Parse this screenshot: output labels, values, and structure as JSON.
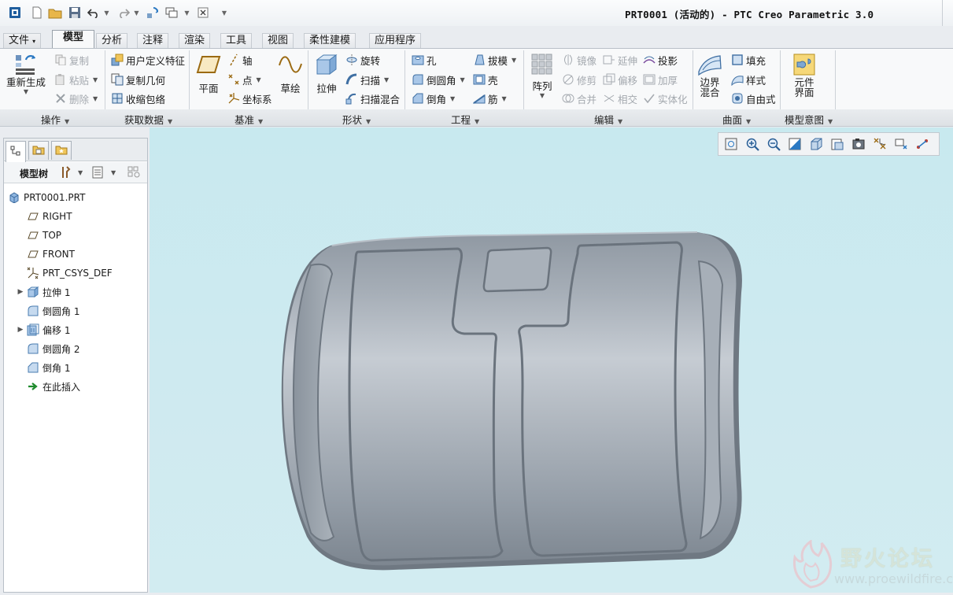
{
  "app": {
    "title": "PRT0001 (活动的) - PTC Creo Parametric 3.0"
  },
  "ribbon_tabs": [
    {
      "label": "文件",
      "caret": "▾"
    },
    {
      "label": "模型"
    },
    {
      "label": "分析"
    },
    {
      "label": "注释"
    },
    {
      "label": "渲染"
    },
    {
      "label": "工具"
    },
    {
      "label": "视图"
    },
    {
      "label": "柔性建模"
    },
    {
      "label": "应用程序"
    }
  ],
  "groups": {
    "operations": {
      "label": "操作",
      "regenerate": "重新生成",
      "copy": "复制",
      "paste": "粘贴",
      "delete": "删除"
    },
    "get_data": {
      "label": "获取数据",
      "udf": "用户定义特征",
      "copy_geom": "复制几何",
      "shrinkwrap": "收缩包络"
    },
    "datum": {
      "label": "基准",
      "plane": "平面",
      "axis": "轴",
      "point": "点",
      "csys": "坐标系",
      "sketch": "草绘"
    },
    "shapes": {
      "label": "形状",
      "extrude": "拉伸",
      "revolve": "旋转",
      "sweep": "扫描",
      "swept_blend": "扫描混合"
    },
    "engineering": {
      "label": "工程",
      "hole": "孔",
      "round": "倒圆角",
      "chamfer": "倒角",
      "draft": "拔模",
      "shell": "壳",
      "rib": "筋"
    },
    "editing": {
      "label": "编辑",
      "pattern": "阵列",
      "mirror": "镜像",
      "trim": "修剪",
      "merge": "合并",
      "extend": "延伸",
      "offset": "偏移",
      "intersect": "相交",
      "project": "投影",
      "thicken": "加厚",
      "solidify": "实体化"
    },
    "surfaces": {
      "label": "曲面",
      "boundary_blend": "边界\n混合",
      "fill": "填充",
      "style": "样式",
      "freestyle": "自由式"
    },
    "model_intent": {
      "label": "模型意图",
      "component_interface": "元件\n界面"
    }
  },
  "model_tree": {
    "header": "模型树",
    "items": [
      {
        "label": "PRT0001.PRT",
        "icon": "part-icon",
        "expandable": false
      },
      {
        "label": "RIGHT",
        "icon": "datum-plane-icon",
        "expandable": false
      },
      {
        "label": "TOP",
        "icon": "datum-plane-icon",
        "expandable": false
      },
      {
        "label": "FRONT",
        "icon": "datum-plane-icon",
        "expandable": false
      },
      {
        "label": "PRT_CSYS_DEF",
        "icon": "csys-icon",
        "expandable": false
      },
      {
        "label": "拉伸 1",
        "icon": "extrude-icon",
        "expandable": true
      },
      {
        "label": "倒圆角 1",
        "icon": "round-icon",
        "expandable": false
      },
      {
        "label": "偏移 1",
        "icon": "offset-icon",
        "expandable": true
      },
      {
        "label": "倒圆角 2",
        "icon": "round-icon",
        "expandable": false
      },
      {
        "label": "倒角 1",
        "icon": "chamfer-icon",
        "expandable": false
      },
      {
        "label": "在此插入",
        "icon": "insert-here-arrow-icon",
        "expandable": false
      }
    ]
  },
  "watermark": {
    "text": "野火论坛",
    "url": "www.proewildfire.cn"
  },
  "colors": {
    "canvas": "#cde9ef",
    "model": "#9aa3ad",
    "ribbon": "#f8f9fa",
    "accent": "#2a78c2"
  }
}
